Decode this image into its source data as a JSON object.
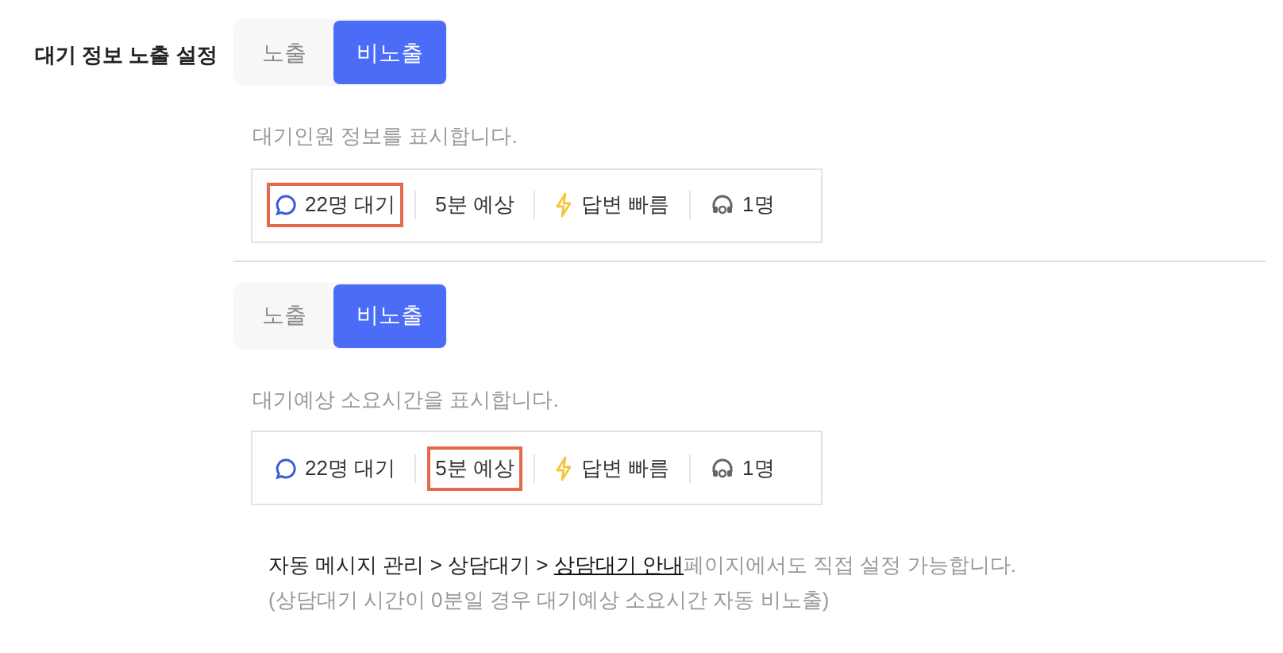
{
  "setting_label": "대기 정보 노출 설정",
  "sections": [
    {
      "options": [
        {
          "label": "노출",
          "selected": false
        },
        {
          "label": "비노출",
          "selected": true
        }
      ],
      "description": "대기인원 정보를 표시합니다.",
      "preview": [
        {
          "kind": "waiting",
          "text": "22명 대기",
          "highlighted": true
        },
        {
          "kind": "time",
          "text": "5분 예상",
          "highlighted": false
        },
        {
          "kind": "speed",
          "text": "답변 빠름",
          "highlighted": false
        },
        {
          "kind": "agents",
          "text": "1명",
          "highlighted": false
        }
      ]
    },
    {
      "options": [
        {
          "label": "노출",
          "selected": false
        },
        {
          "label": "비노출",
          "selected": true
        }
      ],
      "description": "대기예상 소요시간을 표시합니다.",
      "preview": [
        {
          "kind": "waiting",
          "text": "22명 대기",
          "highlighted": false
        },
        {
          "kind": "time",
          "text": "5분 예상",
          "highlighted": true
        },
        {
          "kind": "speed",
          "text": "답변 빠름",
          "highlighted": false
        },
        {
          "kind": "agents",
          "text": "1명",
          "highlighted": false
        }
      ]
    }
  ],
  "footer": {
    "path": "자동 메시지 관리 > 상담대기 > ",
    "link": "상담대기 안내",
    "rest": "페이지에서도 직접 설정 가능합니다.",
    "note": "(상담대기 시간이 0분일 경우 대기예상 소요시간 자동 비노출)"
  }
}
